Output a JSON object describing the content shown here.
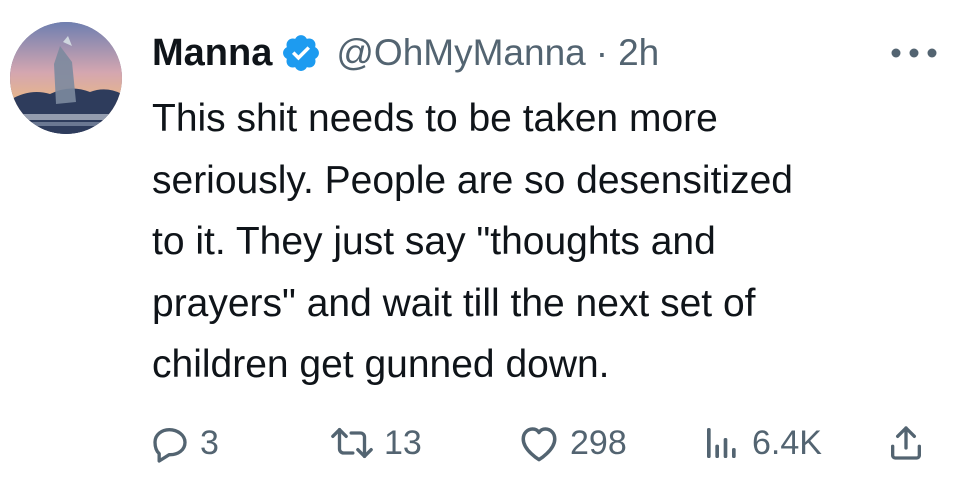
{
  "author": {
    "name": "Manna",
    "handle": "@OhMyManna",
    "separator": "·",
    "time": "2h",
    "verified": true,
    "verified_color": "#1d9bf0"
  },
  "tweet": {
    "lines": [
      "This shit needs to be taken more",
      "seriously. People are so desensitized",
      "to it. They just say \"thoughts and",
      "prayers\" and wait till the next set of",
      "children get gunned down."
    ]
  },
  "actions": {
    "replies": "3",
    "retweets": "13",
    "likes": "298",
    "views": "6.4K"
  },
  "icons": {
    "reply": "reply-icon",
    "retweet": "retweet-icon",
    "like": "heart-icon",
    "views": "views-icon",
    "share": "share-icon",
    "more": "more-icon"
  },
  "colors": {
    "text": "#0f1419",
    "secondary": "#536471",
    "accent": "#1d9bf0"
  }
}
